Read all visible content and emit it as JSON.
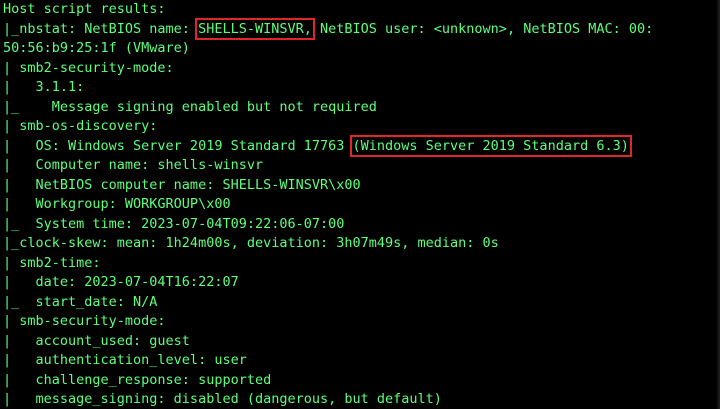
{
  "colors": {
    "background": "#000000",
    "text": "#5dff7a",
    "highlight_box": "#e0262a"
  },
  "terminal": {
    "lines": {
      "l01": "Host script results:",
      "l02_pre": "|_nbstat: NetBIOS name: ",
      "l02_hl": "SHELLS-WINSVR,",
      "l02_post": " NetBIOS user: <unknown>, NetBIOS MAC: 00:",
      "l03": "50:56:b9:25:1f (VMware)",
      "l04": "| smb2-security-mode:",
      "l05": "|   3.1.1:",
      "l06": "|_    Message signing enabled but not required",
      "l07": "| smb-os-discovery:",
      "l08_pre": "|   OS: Windows Server 2019 Standard 17763 ",
      "l08_hl": "(Windows Server 2019 Standard 6.3)",
      "l09": "|   Computer name: shells-winsvr",
      "l10": "|   NetBIOS computer name: SHELLS-WINSVR\\x00",
      "l11": "|   Workgroup: WORKGROUP\\x00",
      "l12": "|_  System time: 2023-07-04T09:22:06-07:00",
      "l13": "|_clock-skew: mean: 1h24m00s, deviation: 3h07m49s, median: 0s",
      "l14": "| smb2-time:",
      "l15": "|   date: 2023-07-04T16:22:07",
      "l16": "|_  start_date: N/A",
      "l17": "| smb-security-mode:",
      "l18": "|   account_used: guest",
      "l19": "|   authentication_level: user",
      "l20": "|   challenge_response: supported",
      "l21": "|   message_signing: disabled (dangerous, but default)"
    }
  }
}
